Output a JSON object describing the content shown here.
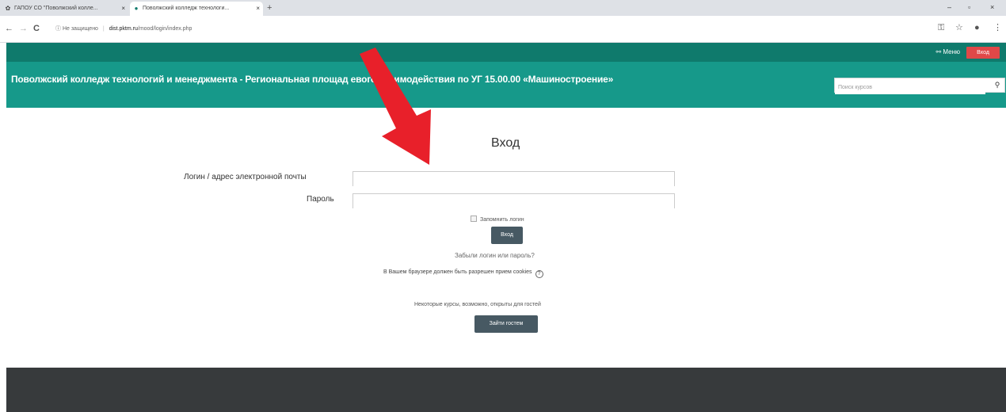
{
  "browser": {
    "tabs": [
      {
        "label": "ГАПОУ СО \"Поволжский колле...",
        "close": "×"
      },
      {
        "label": "Поволжский колледж технологи...",
        "close": "×"
      }
    ],
    "new_tab": "+",
    "window_controls": {
      "minimize": "–",
      "maximize": "▫",
      "close": "×"
    },
    "nav": {
      "back": "←",
      "forward": "→",
      "reload": "C"
    },
    "security": "Не защищено",
    "url_host": "dist.pktm.ru",
    "url_path": "/mood/login/index.php",
    "toolbar": {
      "key": "⚿",
      "star": "☆",
      "profile": "●",
      "more": "⋮"
    }
  },
  "header": {
    "menu_label": "Меню",
    "login_label": "Вход",
    "site_title": "Поволжский колледж технологий и менеджмента - Региональная площад",
    "site_title_tail": "евого взаимодействия по УГ 15.00.00 «Машиностроение»",
    "search_placeholder": "Поиск курсов",
    "search_icon": "magnifier-icon"
  },
  "login": {
    "heading": "Вход",
    "username_label": "Логин / адрес электронной почты",
    "password_label": "Пароль",
    "remember_label": "Запомнить логин",
    "submit_label": "Вход",
    "forgot_link": "Забыли логин или пароль?",
    "cookies_note": "В Вашем браузере должен быть разрешен прием cookies",
    "help_icon": "?",
    "guest_note": "Некоторые курсы, возможно, открыты для гостей",
    "guest_button": "Зайти гостем"
  },
  "colors": {
    "topnav": "#0f7a6c",
    "banner": "#16998a",
    "login_top": "#e04848",
    "button": "#475963",
    "footer": "#373a3c",
    "arrow": "#e8202a"
  }
}
